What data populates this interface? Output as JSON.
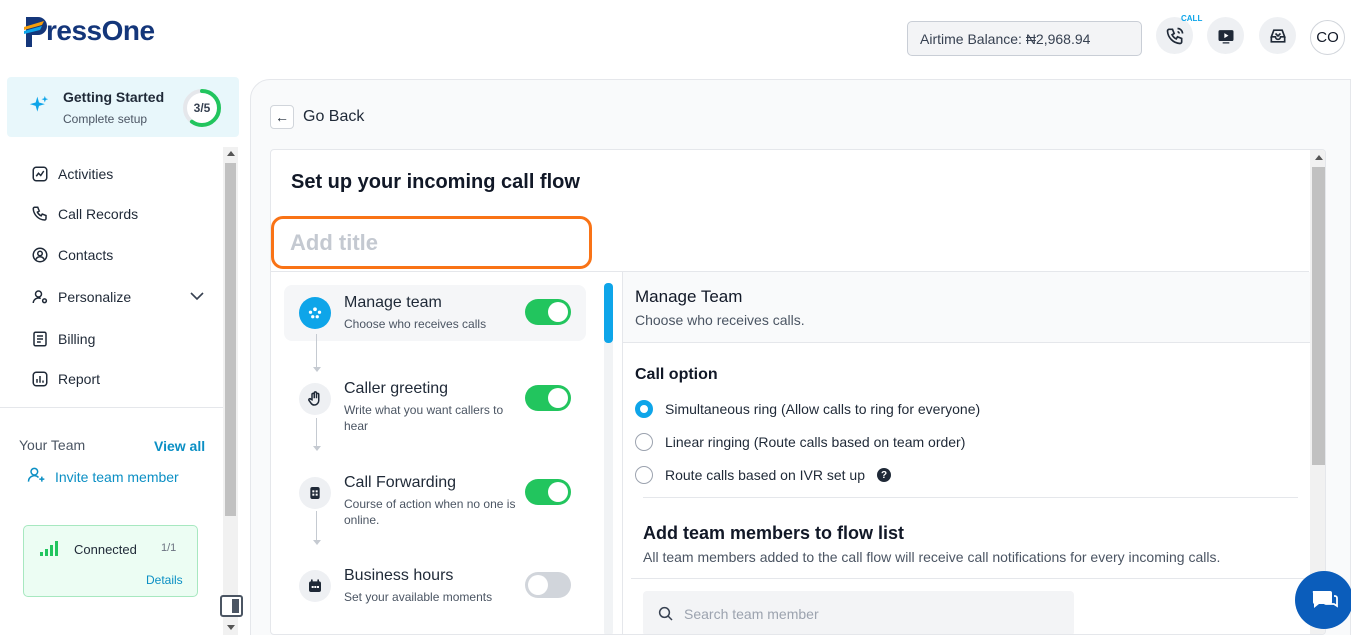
{
  "header": {
    "logo_text": "ressOne",
    "logo_initial": "P",
    "airtime_balance": "Airtime Balance: ₦2,968.94",
    "call_tag": "CALL",
    "avatar_initials": "CO"
  },
  "sidebar": {
    "getting_started": {
      "title": "Getting Started",
      "subtitle": "Complete setup",
      "progress_label": "3/5",
      "progress": 0.6
    },
    "items": [
      {
        "label": "Activities",
        "icon": "activity-icon"
      },
      {
        "label": "Call Records",
        "icon": "phone-icon"
      },
      {
        "label": "Contacts",
        "icon": "user-circle-icon"
      },
      {
        "label": "Personalize",
        "icon": "user-settings-icon"
      },
      {
        "label": "Billing",
        "icon": "receipt-icon"
      },
      {
        "label": "Report",
        "icon": "chart-icon"
      }
    ],
    "team": {
      "label": "Your Team",
      "view_all": "View all",
      "invite": "Invite team member"
    },
    "connection": {
      "status": "Connected",
      "count": "1/1",
      "details": "Details"
    }
  },
  "main": {
    "go_back": "Go Back",
    "card_title": "Set up your incoming call flow",
    "title_placeholder": "Add title",
    "steps": [
      {
        "name": "Manage team",
        "desc": "Choose who receives calls",
        "enabled": true,
        "icon": "team-icon"
      },
      {
        "name": "Caller greeting",
        "desc": "Write what you want callers to hear",
        "enabled": true,
        "icon": "wave-hand-icon"
      },
      {
        "name": "Call Forwarding",
        "desc": "Course of action when no one is online.",
        "enabled": true,
        "icon": "forward-icon"
      },
      {
        "name": "Business hours",
        "desc": "Set your available moments",
        "enabled": false,
        "icon": "calendar-icon"
      }
    ],
    "panel": {
      "title": "Manage Team",
      "subtitle": "Choose who receives calls.",
      "call_option_heading": "Call option",
      "options": [
        {
          "label": "Simultaneous ring (Allow calls to ring for everyone)",
          "selected": true
        },
        {
          "label": "Linear ringing (Route calls based on team order)",
          "selected": false
        },
        {
          "label": "Route calls based on IVR set up",
          "selected": false
        }
      ],
      "add_heading": "Add team members to flow list",
      "add_sub": "All team members added to the call flow will receive call notifications for every incoming calls.",
      "search_placeholder": "Search team member"
    }
  },
  "colors": {
    "brand": "#14367a",
    "accent": "#0ea5e9",
    "toggle_on": "#22c55e",
    "highlight": "#f97316"
  }
}
